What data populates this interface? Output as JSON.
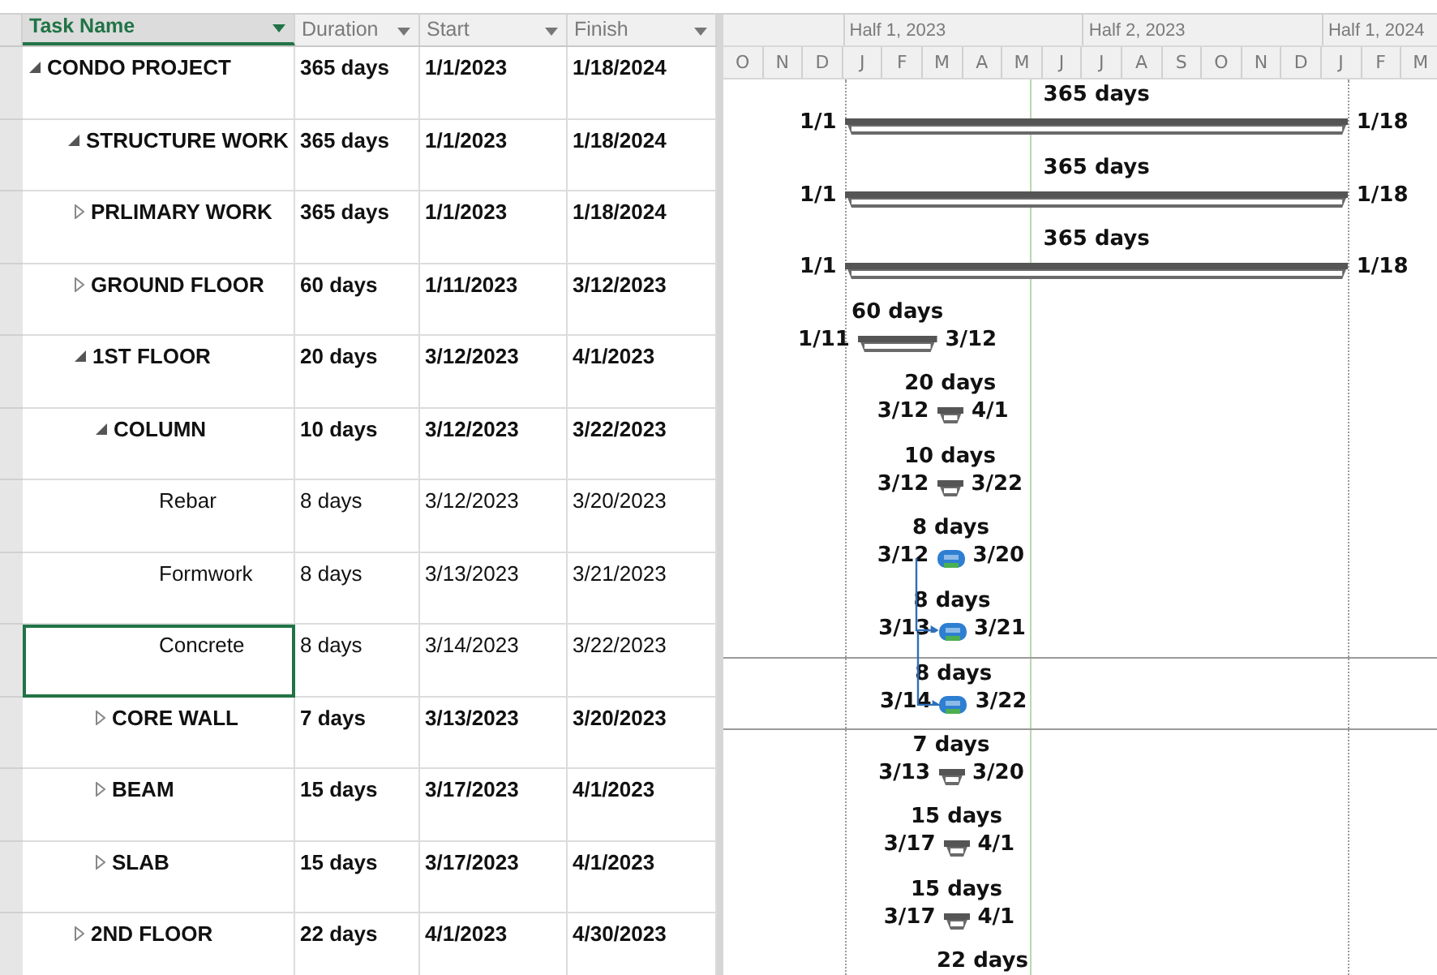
{
  "table": {
    "columns": [
      {
        "label": "Task Name",
        "selected": true
      },
      {
        "label": "Duration",
        "selected": false
      },
      {
        "label": "Start",
        "selected": false
      },
      {
        "label": "Finish",
        "selected": false
      }
    ]
  },
  "timescale": {
    "top": [
      "Half 1, 2023",
      "Half 2, 2023",
      "Half 1, 2024"
    ],
    "bottom": [
      "O",
      "N",
      "D",
      "J",
      "F",
      "M",
      "A",
      "M",
      "J",
      "J",
      "A",
      "S",
      "O",
      "N",
      "D",
      "J",
      "F",
      "M"
    ]
  },
  "tasks": [
    {
      "name": "CONDO PROJECT",
      "kind": "summary",
      "expanded": true,
      "selected": false,
      "duration": "365 days",
      "start": "1/1/2023",
      "finish": "1/18/2024",
      "bar": {
        "duration": "365 days",
        "start": "1/1",
        "finish": "1/18"
      },
      "children": [
        {
          "name": "STRUCTURE WORK",
          "kind": "summary",
          "expanded": true,
          "selected": false,
          "duration": "365 days",
          "start": "1/1/2023",
          "finish": "1/18/2024",
          "bar": {
            "duration": "365 days",
            "start": "1/1",
            "finish": "1/18"
          },
          "children": [
            {
              "name": "PRLIMARY WORK",
              "kind": "summary",
              "expanded": false,
              "selected": false,
              "duration": "365 days",
              "start": "1/1/2023",
              "finish": "1/18/2024",
              "bar": {
                "duration": "365 days",
                "start": "1/1",
                "finish": "1/18"
              }
            },
            {
              "name": "GROUND FLOOR",
              "kind": "summary",
              "expanded": false,
              "selected": false,
              "duration": "60 days",
              "start": "1/11/2023",
              "finish": "3/12/2023",
              "bar": {
                "duration": "60 days",
                "start": "1/11",
                "finish": "3/12"
              }
            },
            {
              "name": "1ST FLOOR",
              "kind": "summary",
              "expanded": true,
              "selected": false,
              "duration": "20 days",
              "start": "3/12/2023",
              "finish": "4/1/2023",
              "bar": {
                "duration": "20 days",
                "start": "3/12",
                "finish": "4/1"
              },
              "children": [
                {
                  "name": "COLUMN",
                  "kind": "summary",
                  "expanded": true,
                  "selected": false,
                  "duration": "10 days",
                  "start": "3/12/2023",
                  "finish": "3/22/2023",
                  "bar": {
                    "duration": "10 days",
                    "start": "3/12",
                    "finish": "3/22"
                  },
                  "children": [
                    {
                      "name": "Rebar",
                      "kind": "task",
                      "selected": false,
                      "duration": "8 days",
                      "start": "3/12/2023",
                      "finish": "3/20/2023",
                      "bar": {
                        "duration": "8 days",
                        "start": "3/12",
                        "finish": "3/20"
                      }
                    },
                    {
                      "name": "Formwork",
                      "kind": "task",
                      "linked": true,
                      "selected": false,
                      "duration": "8 days",
                      "start": "3/13/2023",
                      "finish": "3/21/2023",
                      "bar": {
                        "duration": "8 days",
                        "start": "3/13",
                        "finish": "3/21"
                      }
                    },
                    {
                      "name": "Concrete",
                      "kind": "task",
                      "linked": true,
                      "selected": true,
                      "duration": "8 days",
                      "start": "3/14/2023",
                      "finish": "3/22/2023",
                      "bar": {
                        "duration": "8 days",
                        "start": "3/14",
                        "finish": "3/22"
                      }
                    }
                  ]
                },
                {
                  "name": "CORE WALL",
                  "kind": "summary",
                  "expanded": false,
                  "selected": false,
                  "duration": "7 days",
                  "start": "3/13/2023",
                  "finish": "3/20/2023",
                  "bar": {
                    "duration": "7 days",
                    "start": "3/13",
                    "finish": "3/20"
                  }
                },
                {
                  "name": "BEAM",
                  "kind": "summary",
                  "expanded": false,
                  "selected": false,
                  "duration": "15 days",
                  "start": "3/17/2023",
                  "finish": "4/1/2023",
                  "bar": {
                    "duration": "15 days",
                    "start": "3/17",
                    "finish": "4/1"
                  }
                },
                {
                  "name": "SLAB",
                  "kind": "summary",
                  "expanded": false,
                  "selected": false,
                  "duration": "15 days",
                  "start": "3/17/2023",
                  "finish": "4/1/2023",
                  "bar": {
                    "duration": "15 days",
                    "start": "3/17",
                    "finish": "4/1"
                  }
                }
              ]
            },
            {
              "name": "2ND FLOOR",
              "kind": "summary",
              "expanded": false,
              "selected": false,
              "duration": "22 days",
              "start": "4/1/2023",
              "finish": "4/30/2023",
              "bar": {
                "duration": "22 days"
              }
            }
          ]
        }
      ]
    }
  ]
}
